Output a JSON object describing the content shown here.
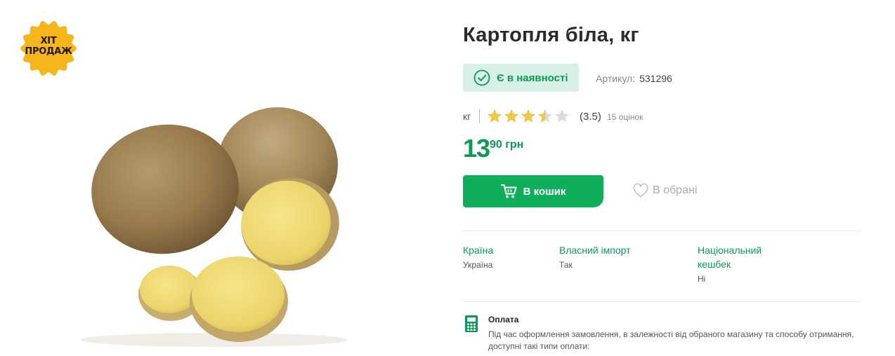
{
  "badge": {
    "line1": "ХІТ",
    "line2": "ПРОДАЖ"
  },
  "product": {
    "title": "Картопля біла, кг",
    "stock_label": "Є в наявності",
    "sku_label": "Артикул:",
    "sku_value": "531296",
    "unit": "кг",
    "rating": 3.5,
    "rating_text": "(3.5)",
    "reviews_text": "15 оцінок",
    "price_int": "13",
    "price_frac": "90 грн"
  },
  "actions": {
    "cart_label": "В кошик",
    "favorite_label": "В обрані"
  },
  "attributes": [
    {
      "label": "Країна",
      "value": "Україна"
    },
    {
      "label": "Власний імпорт",
      "value": "Так"
    },
    {
      "label": "Національний кешбек",
      "value": "Ні"
    }
  ],
  "payment": {
    "title": "Оплата",
    "text": "Під час оформлення замовлення, в залежності від обраного магазину та способу отримання, доступні такі типи оплати:"
  },
  "colors": {
    "accent": "#0fae5b",
    "accent_text": "#0b9a55",
    "stock_bg": "#d9f0e6",
    "badge": "#f7b51c",
    "star": "#f2c744",
    "star_empty": "#dcdcdc"
  },
  "icons": [
    "check-circle-icon",
    "star-icon",
    "cart-icon",
    "heart-icon",
    "payment-terminal-icon"
  ]
}
